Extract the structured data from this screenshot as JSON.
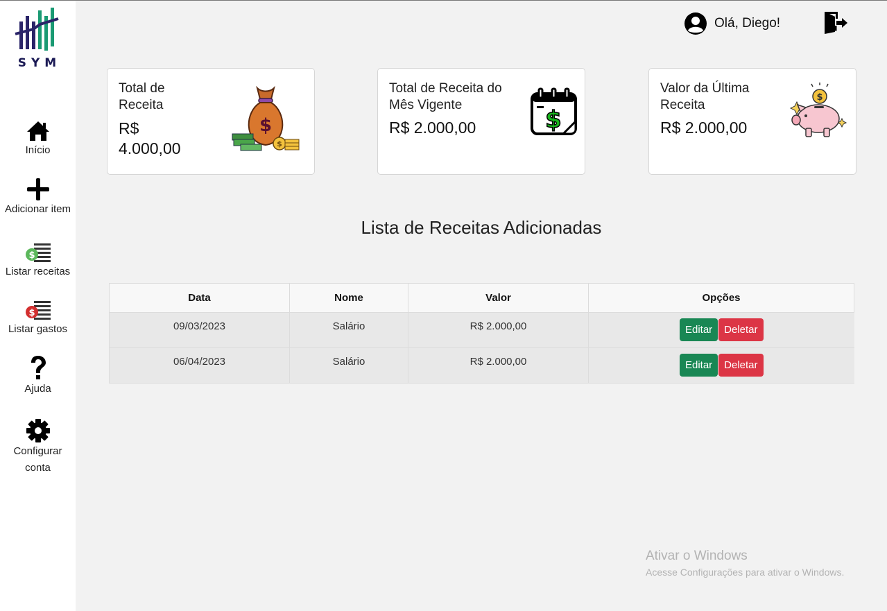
{
  "brand": {
    "logo_text": "SYM"
  },
  "sidebar": {
    "items": [
      {
        "label": "Início",
        "icon": "home-icon"
      },
      {
        "label": "Adicionar item",
        "icon": "plus-icon"
      },
      {
        "label": "Listar receitas",
        "icon": "list-income-icon"
      },
      {
        "label": "Listar gastos",
        "icon": "list-expense-icon"
      },
      {
        "label": "Ajuda",
        "icon": "help-icon"
      },
      {
        "label": "Configurar conta",
        "icon": "gear-icon"
      }
    ]
  },
  "header": {
    "greeting": "Olá, Diego!",
    "user_icon": "user-icon",
    "logout_icon": "logout-icon"
  },
  "cards": [
    {
      "title": "Total de Receita",
      "value": "R$ 4.000,00",
      "icon": "money-bag-icon"
    },
    {
      "title": "Total de Receita do Mês Vigente",
      "value": "R$ 2.000,00",
      "icon": "calendar-dollar-icon"
    },
    {
      "title": "Valor da Última Receita",
      "value": "R$ 2.000,00",
      "icon": "piggy-bank-icon"
    }
  ],
  "section_title": "Lista de Receitas Adicionadas",
  "table": {
    "columns": [
      "Data",
      "Nome",
      "Valor",
      "Opções"
    ],
    "rows": [
      {
        "data": "09/03/2023",
        "nome": "Salário",
        "valor": "R$ 2.000,00"
      },
      {
        "data": "06/04/2023",
        "nome": "Salário",
        "valor": "R$ 2.000,00"
      }
    ],
    "edit_label": "Editar",
    "delete_label": "Deletar"
  },
  "watermark": {
    "title": "Ativar o Windows",
    "subtitle": "Acesse Configurações para ativar o Windows."
  },
  "colors": {
    "edit": "#198754",
    "delete": "#dc3545",
    "logo_dark": "#1b1a55",
    "logo_green": "#1a9a73"
  }
}
